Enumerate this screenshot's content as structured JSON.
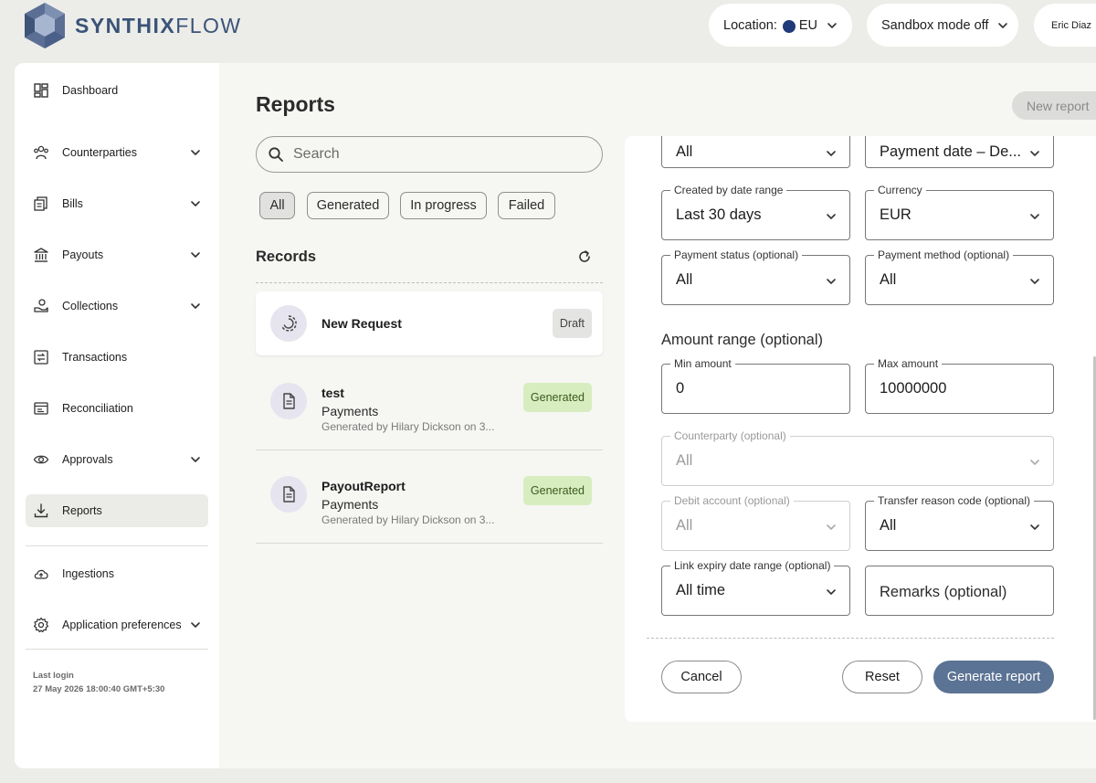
{
  "header": {
    "brand_bold": "SYNTHIX",
    "brand_light": "FLOW",
    "location_label": "Location:",
    "location_value": "EU",
    "sandbox_label": "Sandbox mode off",
    "user_name": "Eric Diaz"
  },
  "sidebar": {
    "items": [
      {
        "label": "Dashboard",
        "icon": "dashboard-icon"
      },
      {
        "label": "Counterparties",
        "icon": "people-icon"
      },
      {
        "label": "Bills",
        "icon": "bills-icon"
      },
      {
        "label": "Payouts",
        "icon": "bank-icon"
      },
      {
        "label": "Collections",
        "icon": "collections-icon"
      },
      {
        "label": "Transactions",
        "icon": "transactions-icon"
      },
      {
        "label": "Reconciliation",
        "icon": "reconciliation-icon"
      },
      {
        "label": "Approvals",
        "icon": "eye-icon"
      },
      {
        "label": "Reports",
        "icon": "download-icon"
      },
      {
        "label": "Ingestions",
        "icon": "cloud-upload-icon"
      },
      {
        "label": "Application preferences",
        "icon": "gear-icon"
      }
    ],
    "last_login_label": "Last login",
    "last_login_value": "27 May 2026 18:00:40 GMT+5:30"
  },
  "reports": {
    "title": "Reports",
    "new_report_label": "New report",
    "search_placeholder": "Search",
    "filters": [
      "All",
      "Generated",
      "In progress",
      "Failed"
    ],
    "records_title": "Records",
    "records": [
      {
        "title": "New Request",
        "badge": "Draft"
      },
      {
        "title": "test",
        "type": "Payments",
        "meta": "Generated by Hilary Dickson on 3...",
        "badge": "Generated"
      },
      {
        "title": "PayoutReport",
        "type": "Payments",
        "meta": "Generated by Hilary Dickson on 3...",
        "badge": "Generated"
      }
    ]
  },
  "form": {
    "top_left_value": "All",
    "top_right_value": "Payment date – De...",
    "created_range_label": "Created by date range",
    "created_range_value": "Last 30 days",
    "currency_label": "Currency",
    "currency_value": "EUR",
    "payment_status_label": "Payment status (optional)",
    "payment_status_value": "All",
    "payment_method_label": "Payment method (optional)",
    "payment_method_value": "All",
    "amount_range_label": "Amount range (optional)",
    "min_amount_label": "Min amount",
    "min_amount_value": "0",
    "max_amount_label": "Max amount",
    "max_amount_value": "10000000",
    "counterparty_label": "Counterparty (optional)",
    "counterparty_value": "All",
    "debit_account_label": "Debit account (optional)",
    "debit_account_value": "All",
    "transfer_reason_label": "Transfer reason code (optional)",
    "transfer_reason_value": "All",
    "link_expiry_label": "Link expiry date range (optional)",
    "link_expiry_value": "All time",
    "remarks_placeholder": "Remarks (optional)",
    "cancel_label": "Cancel",
    "reset_label": "Reset",
    "generate_label": "Generate report"
  }
}
